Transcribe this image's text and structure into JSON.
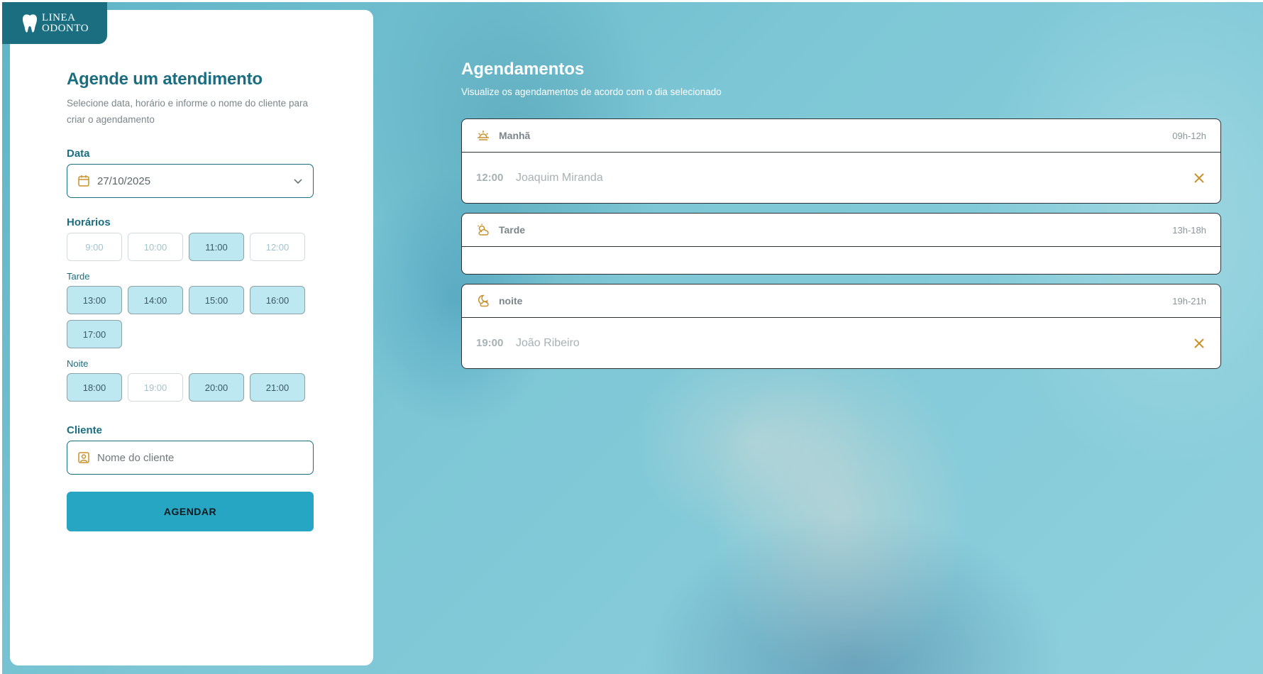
{
  "brand": {
    "line1": "LINEA",
    "line2": "ODONTO"
  },
  "form": {
    "title": "Agende um atendimento",
    "subtitle": "Selecione data, horário e informe o nome do cliente para criar o agendamento",
    "date_label": "Data",
    "date_value": "27/10/2025",
    "times_label": "Horários",
    "morning_slots": [
      {
        "time": "9:00",
        "available": false
      },
      {
        "time": "10:00",
        "available": false
      },
      {
        "time": "11:00",
        "available": true
      },
      {
        "time": "12:00",
        "available": false
      }
    ],
    "afternoon_label": "Tarde",
    "afternoon_slots": [
      {
        "time": "13:00",
        "available": true
      },
      {
        "time": "14:00",
        "available": true
      },
      {
        "time": "15:00",
        "available": true
      },
      {
        "time": "16:00",
        "available": true
      },
      {
        "time": "17:00",
        "available": true
      }
    ],
    "night_label": "Noite",
    "night_slots": [
      {
        "time": "18:00",
        "available": true
      },
      {
        "time": "19:00",
        "available": false
      },
      {
        "time": "20:00",
        "available": true
      },
      {
        "time": "21:00",
        "available": true
      }
    ],
    "client_label": "Cliente",
    "client_placeholder": "Nome do cliente",
    "submit_label": "AGENDAR"
  },
  "schedule": {
    "title": "Agendamentos",
    "subtitle": "Visualize os agendamentos de acordo com o dia selecionado",
    "periods": [
      {
        "name": "Manhã",
        "range": "09h-12h",
        "icon": "sunrise-icon",
        "appointments": [
          {
            "time": "12:00",
            "client": "Joaquim Miranda"
          }
        ]
      },
      {
        "name": "Tarde",
        "range": "13h-18h",
        "icon": "cloud-sun-icon",
        "appointments": []
      },
      {
        "name": "noite",
        "range": "19h-21h",
        "icon": "cloud-moon-icon",
        "appointments": [
          {
            "time": "19:00",
            "client": "João Ribeiro"
          }
        ]
      }
    ]
  },
  "colors": {
    "brand": "#1a6e80",
    "accent": "#27a6c4",
    "slot_available": "#bde8f2",
    "icon_gold": "#c8912d"
  }
}
